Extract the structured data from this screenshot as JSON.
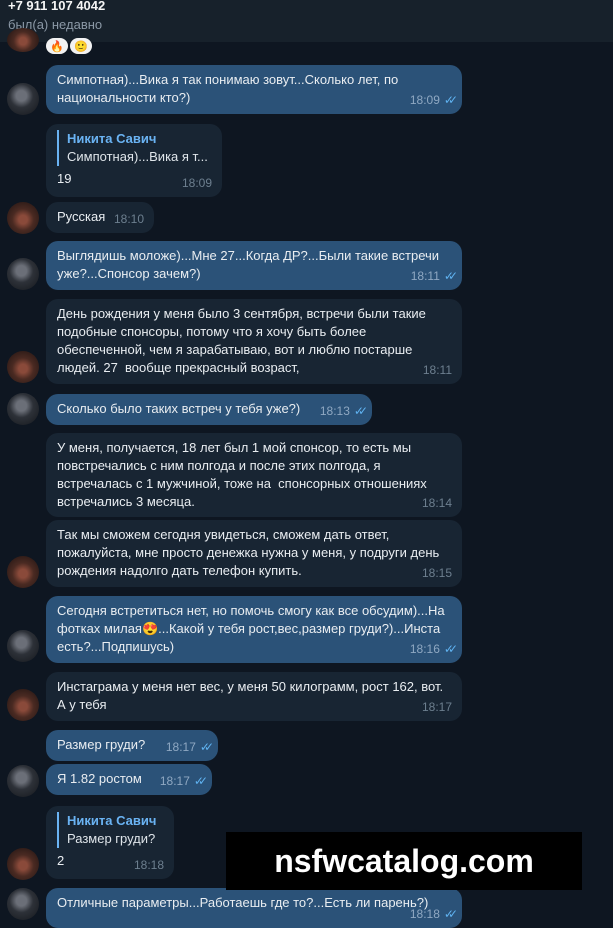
{
  "header": {
    "name": "+7 911 107 4042",
    "status": "был(а) недавно"
  },
  "reactions": [
    "🔥",
    "🙂"
  ],
  "messages": [
    {
      "dir": "out",
      "text": "Симпотная)...Вика я так понимаю зовут...Сколько лет, по национальности кто?)",
      "time": "18:09",
      "read": true
    },
    {
      "dir": "in",
      "reply_name": "Никита Савич",
      "reply_text": "Симпотная)...Вика я т...",
      "text": "19",
      "time": "18:09"
    },
    {
      "dir": "in",
      "text": "Русская",
      "time": "18:10"
    },
    {
      "dir": "out",
      "text": "Выглядишь моложе)...Мне 27...Когда ДР?...Были такие встречи уже?...Спонсор зачем?)",
      "time": "18:11",
      "read": true
    },
    {
      "dir": "in",
      "text": "День рождения у меня было 3 сентября, встречи были такие подобные спонсоры, потому что я хочу быть более обеспеченной, чем я зарабатываю, вот и люблю постарше людей. 27  вообще прекрасный возраст,",
      "time": "18:11"
    },
    {
      "dir": "out",
      "text": "Сколько было таких встреч у тебя уже?)",
      "time": "18:13",
      "read": true
    },
    {
      "dir": "in",
      "text": "У меня, получается, 18 лет был 1 мой спонсор, то есть мы повстречались с ним полгода и после этих полгода, я встречалась с 1 мужчиной, тоже на  спонсорных отношениях встречались 3 месяца.",
      "time": "18:14"
    },
    {
      "dir": "in",
      "text": "Так мы сможем сегодня увидеться, сможем дать ответ, пожалуйста, мне просто денежка нужна у меня, у подруги день рождения надолго дать телефон купить.",
      "time": "18:15"
    },
    {
      "dir": "out",
      "text": "Сегодня встретиться нет, но помочь смогу как все обсудим)...На фотках милая😍...Какой у тебя рост,вес,размер груди?)...Инста есть?...Подпишусь)",
      "time": "18:16",
      "read": true
    },
    {
      "dir": "in",
      "text": "Инстаграма у меня нет вес, у меня 50 килограмм, рост 162, вот. А у тебя",
      "time": "18:17"
    },
    {
      "dir": "out",
      "text": "Размер груди?",
      "time": "18:17",
      "read": true
    },
    {
      "dir": "out",
      "text": "Я 1.82 ростом",
      "time": "18:17",
      "read": true
    },
    {
      "dir": "in",
      "reply_name": "Никита Савич",
      "reply_text": "Размер груди?",
      "text": "2",
      "time": "18:18"
    },
    {
      "dir": "out",
      "text": "Отличные параметры...Работаешь где то?...Есть ли парень?)",
      "time": "18:18",
      "read": true
    }
  ],
  "watermark": "nsfwcatalog.com",
  "colors": {
    "background": "#0e1621",
    "outgoing": "#2b5278",
    "incoming": "#182533",
    "accent": "#6ab3f3"
  }
}
